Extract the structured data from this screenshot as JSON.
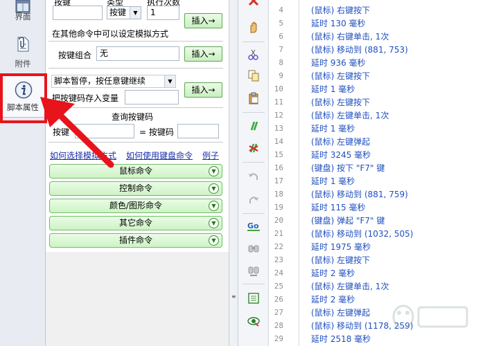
{
  "nav": {
    "items": [
      {
        "label": "界面"
      },
      {
        "label": "附件"
      },
      {
        "label": "脚本属性"
      }
    ]
  },
  "panel": {
    "top_labels": {
      "key": "按键",
      "type": "类型",
      "exec_count": "执行次数"
    },
    "key_type_value": "按键",
    "exec_count_value": "1",
    "insert_label": "插入→",
    "other_cmd_hint": "在其他命令中可以设定模拟方式",
    "key_combo_label": "按键组合",
    "key_combo_value": "无",
    "pause_option": "脚本暂停，按任意键继续",
    "store_key_label": "把按键码存入变量",
    "query_title": "查询按键码",
    "query_key_label": "按键",
    "query_code_label": "= 按键码",
    "links": [
      "如何选择模拟方式",
      "如何使用键盘命令",
      "例子"
    ],
    "categories": [
      "鼠标命令",
      "控制命令",
      "颜色/图形命令",
      "其它命令",
      "插件命令"
    ]
  },
  "code": {
    "line_numbers": [
      4,
      5,
      6,
      7,
      8,
      9,
      10,
      11,
      12,
      13,
      14,
      15,
      16,
      17,
      18,
      19,
      20,
      21,
      22,
      23,
      24,
      25,
      26,
      27,
      28,
      29
    ],
    "lines": [
      "(鼠标) 右键按下",
      "延时 130 毫秒",
      "(鼠标) 右键单击, 1次",
      "(鼠标) 移动到 (881, 753)",
      "延时 936 毫秒",
      "(鼠标) 左键按下",
      "延时 1 毫秒",
      "(鼠标) 左键按下",
      "(鼠标) 左键单击, 1次",
      "延时 1 毫秒",
      "(鼠标) 左键弹起",
      "延时 3245 毫秒",
      "(键盘) 按下 \"F7\" 键",
      "延时 1 毫秒",
      "(鼠标) 移动到 (881, 759)",
      "延时 115 毫秒",
      "(键盘) 弹起 \"F7\" 键",
      "(鼠标) 移动到 (1032, 505)",
      "延时 1975 毫秒",
      "(鼠标) 左键按下",
      "延时 2 毫秒",
      "(鼠标) 左键单击, 1次",
      "延时 2 毫秒",
      "(鼠标) 左键弹起",
      "(鼠标) 移动到 (1178, 259)",
      "延时 2518 毫秒"
    ]
  },
  "colors": {
    "annotation": "#e8141c",
    "code_text": "#1f4fbf",
    "button_green": "#c9f0c0"
  }
}
